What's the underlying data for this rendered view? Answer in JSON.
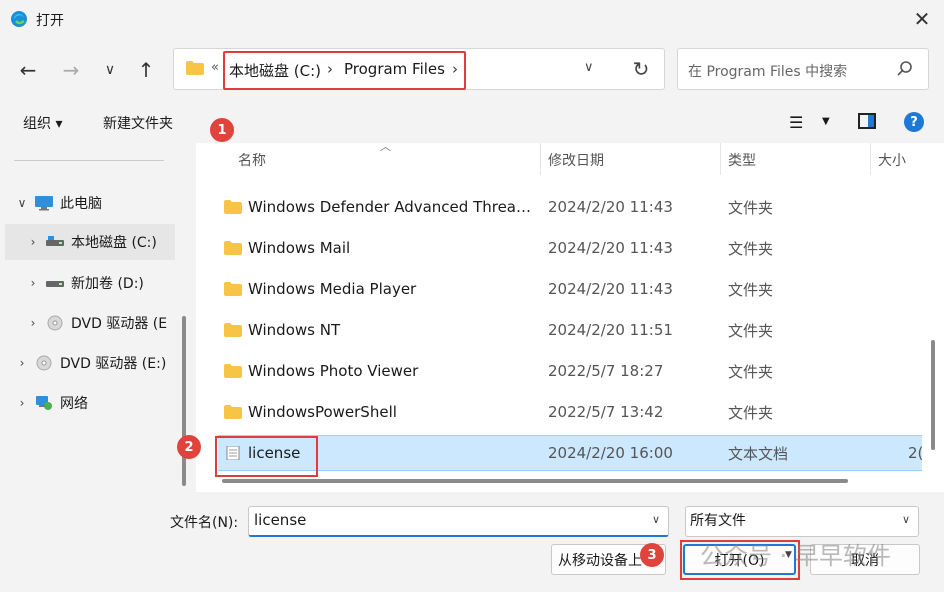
{
  "window": {
    "title": "打开"
  },
  "address": {
    "overflow": "«",
    "crumbs": [
      "本地磁盘 (C:)",
      "Program Files"
    ],
    "sep": "›"
  },
  "search": {
    "placeholder": "在 Program Files 中搜索"
  },
  "toolbar": {
    "organize": "组织 ▾",
    "new_folder": "新建文件夹"
  },
  "badges": [
    "1",
    "2",
    "3"
  ],
  "tree": {
    "items": [
      {
        "label": "此电脑",
        "icon": "monitor-icon"
      },
      {
        "label": "本地磁盘 (C:)",
        "icon": "drive-icon"
      },
      {
        "label": "新加卷 (D:)",
        "icon": "drive-icon"
      },
      {
        "label": "DVD 驱动器 (E",
        "icon": "dvd-icon"
      },
      {
        "label": "DVD 驱动器 (E:)",
        "icon": "dvd-icon"
      },
      {
        "label": "网络",
        "icon": "network-icon"
      }
    ]
  },
  "columns": {
    "name": "名称",
    "date": "修改日期",
    "type": "类型",
    "size": "大小"
  },
  "files": [
    {
      "name": "Windows Defender Advanced Threat...",
      "date": "2024/2/20 11:43",
      "type": "文件夹",
      "size": ""
    },
    {
      "name": "Windows Mail",
      "date": "2024/2/20 11:43",
      "type": "文件夹",
      "size": ""
    },
    {
      "name": "Windows Media Player",
      "date": "2024/2/20 11:43",
      "type": "文件夹",
      "size": ""
    },
    {
      "name": "Windows NT",
      "date": "2024/2/20 11:51",
      "type": "文件夹",
      "size": ""
    },
    {
      "name": "Windows Photo Viewer",
      "date": "2022/5/7 18:27",
      "type": "文件夹",
      "size": ""
    },
    {
      "name": "WindowsPowerShell",
      "date": "2022/5/7 13:42",
      "type": "文件夹",
      "size": ""
    },
    {
      "name": "license",
      "date": "2024/2/20 16:00",
      "type": "文本文档",
      "size": "2("
    }
  ],
  "bottom": {
    "filename_label": "文件名(N):",
    "filename_value": "license",
    "filetype": "所有文件",
    "mobile": "从移动设备上",
    "open": "打开(O)",
    "cancel": "取消"
  },
  "watermark": "公众号 · 早早软件",
  "colors": {
    "accent": "#1e78d4",
    "highlight": "#e23b3b",
    "selection": "#cce8ff",
    "folder": "#f8c445"
  }
}
